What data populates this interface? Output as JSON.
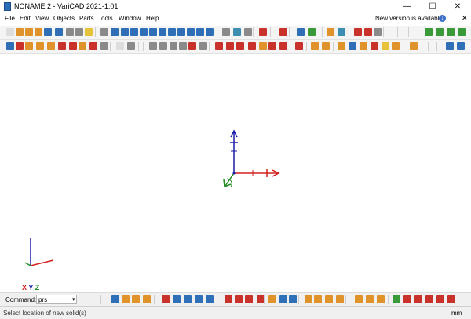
{
  "window": {
    "title": "NONAME 2 - VariCAD 2021-1.01",
    "minimize": "—",
    "maximize": "☐",
    "close": "✕"
  },
  "menu": {
    "items": [
      "File",
      "Edit",
      "View",
      "Objects",
      "Parts",
      "Tools",
      "Window",
      "Help"
    ],
    "update_notice": "New version is available",
    "update_badge": "↓",
    "mdi_close": "✕"
  },
  "axes_label": {
    "x": "X",
    "y": "Y",
    "z": "Z"
  },
  "command": {
    "label": "Command:",
    "value": "prs",
    "dropdown": "▾"
  },
  "status": {
    "message": "Select location of new solid(s)",
    "units": "mm"
  },
  "colors": {
    "x_axis": "#d42020",
    "y_axis": "#1f8a1f",
    "z_axis": "#1c1ca8",
    "accent": "#3a6ec9"
  }
}
